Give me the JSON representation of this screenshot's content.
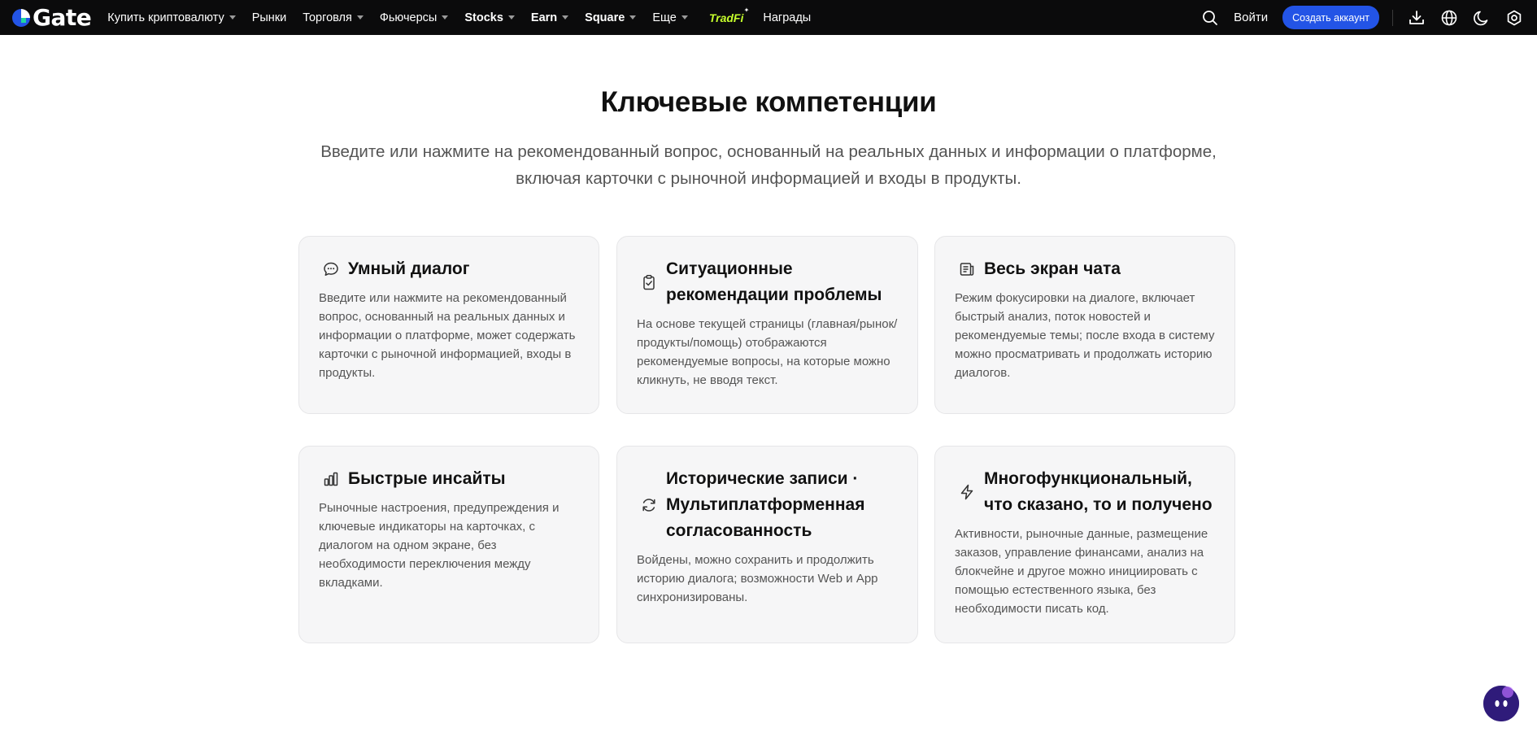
{
  "brand": {
    "name": "Gate"
  },
  "nav": {
    "items": [
      {
        "label": "Купить криптовалюту",
        "caret": true
      },
      {
        "label": "Рынки",
        "caret": false
      },
      {
        "label": "Торговля",
        "caret": true
      },
      {
        "label": "Фьючерсы",
        "caret": true
      },
      {
        "label": "Stocks",
        "caret": true
      },
      {
        "label": "Earn",
        "caret": true
      },
      {
        "label": "Square",
        "caret": true
      },
      {
        "label": "Еще",
        "caret": true
      }
    ],
    "tradfi": "TradFi",
    "rewards": "Награды"
  },
  "header_right": {
    "login": "Войти",
    "signup": "Создать аккаунт",
    "icons": [
      "search-icon",
      "download-icon",
      "globe-icon",
      "moon-icon",
      "settings-icon"
    ]
  },
  "section": {
    "title": "Ключевые компетенции",
    "subtitle": "Введите или нажмите на рекомендованный вопрос, основанный на реальных данных и информации о платформе, включая карточки с рыночной информацией и входы в продукты."
  },
  "cards": [
    {
      "icon": "chat-bubble-icon",
      "title": "Умный диалог",
      "desc": "Введите или нажмите на рекомендованный вопрос, основанный на реальных данных и информации о платформе, может содержать карточки с рыночной информацией, входы в продукты."
    },
    {
      "icon": "clipboard-check-icon",
      "title": "Ситуационные рекомендации проблемы",
      "desc": "На основе текущей страницы (главная/рынок/продукты/помощь) отображаются рекомендуемые вопросы, на которые можно кликнуть, не вводя текст."
    },
    {
      "icon": "document-list-icon",
      "title": "Весь экран чата",
      "desc": "Режим фокусировки на диалоге, включает быстрый анализ, поток новостей и рекомендуемые темы; после входа в систему можно просматривать и продолжать историю диалогов."
    },
    {
      "icon": "bar-chart-icon",
      "title": "Быстрые инсайты",
      "desc": "Рыночные настроения, предупреждения и ключевые индикаторы на карточках, с диалогом на одном экране, без необходимости переключения между вкладками."
    },
    {
      "icon": "sync-icon",
      "title": "Исторические записи · Мультиплатформенная согласованность",
      "desc": "Войдены, можно сохранить и продолжить историю диалога; возможности Web и App синхронизированы."
    },
    {
      "icon": "lightning-icon",
      "title": "Многофункциональный, что сказано, то и получено",
      "desc": "Активности, рыночные данные, размещение заказов, управление финансами, анализ на блокчейне и другое можно инициировать с помощью естественного языка, без необходимости писать код."
    }
  ],
  "colors": {
    "accent": "#2354e6",
    "tradfi": "#c6ff2c",
    "topbar": "#0b0b0c",
    "card_bg": "#f6f6f7"
  }
}
